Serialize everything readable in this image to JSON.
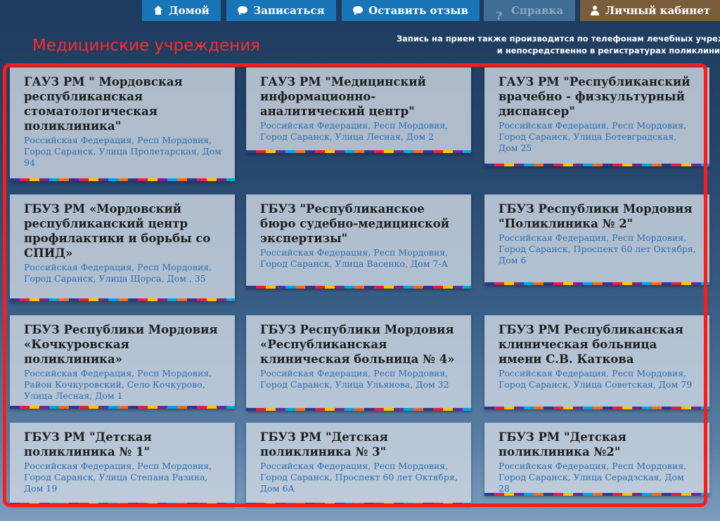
{
  "nav": {
    "home": "Домой",
    "signup": "Записаться",
    "feedback": "Оставить отзыв",
    "help": "Справка",
    "cabinet": "Личный кабинет"
  },
  "notice": {
    "line1": "Запись на прием также производится по телефонам лечебных учреждени",
    "line2": "и непосредственно в регистратурах поликлини"
  },
  "section_title": "Медицинские учреждения",
  "institutions": [
    {
      "name": "ГАУЗ РМ \" Мордовская республиканская стоматологическая поликлиника\"",
      "address": "Российская Федерация, Респ Мордовия, Город Саранск, Улица Пролетарская, Дом 94"
    },
    {
      "name": "ГАУЗ РМ \"Медицинский информационно-аналитический центр\"",
      "address": "Российская Федерация, Респ Мордовия, Город Саранск, Улица Лесная, Дом 2"
    },
    {
      "name": "ГАУЗ РМ \"Республиканский врачебно - физкультурный диспансер\"",
      "address": "Российская Федерация, Респ Мордовия, Город Саранск, Улица Ботевградская, Дом 25"
    },
    {
      "name": "ГБУЗ РМ «Мордовский республиканский центр профилактики и борьбы со СПИД»",
      "address": "Российская Федерация, Респ Мордовия, Город Саранск, Улица Щорса, Дом , 35"
    },
    {
      "name": "ГБУЗ \"Республиканское бюро судебно-медицинской экспертизы\"",
      "address": "Российская Федерация, Респ Мордовия, Город Саранск, Улица Васенко, Дом 7-А"
    },
    {
      "name": "ГБУЗ Республики Мордовия \"Поликлиника № 2\"",
      "address": "Российская Федерация, Респ Мордовия, Город Саранск, Проспект 60 лет Октября, Дом 6"
    },
    {
      "name": "ГБУЗ Республики Мордовия «Кочкуровская поликлиника»",
      "address": "Российская Федерация, Респ Мордовия, Район Кочкуровский, Село Кочкурово, Улица Лесная, Дом 1"
    },
    {
      "name": "ГБУЗ Республики Мордовия «Республиканская клиническая больница № 4»",
      "address": "Российская Федерация, Респ Мордовия, Город Саранск, Улица Ульянова, Дом 32"
    },
    {
      "name": "ГБУЗ РМ Республиканская клиническая больница имени С.В. Каткова",
      "address": "Российская Федерация, Респ Мордовия, Город Саранск, Улица Советская, Дом 79"
    },
    {
      "name": "ГБУЗ РМ \"Детская поликлиника № 1\"",
      "address": "Российская Федерация, Респ Мордовия, Город Саранск, Улица Степана Разина, Дом 19"
    },
    {
      "name": "ГБУЗ РМ \"Детская поликлиника № 3\"",
      "address": "Российская Федерация, Респ Мордовия, Город Саранск, Проспект 60 лет Октября, Дом 6А"
    },
    {
      "name": "ГБУЗ РМ \"Детская поликлиника №2\"",
      "address": "Российская Федерация, Респ Мордовия, Город Саранск, Улица Серадзская, Дом 28"
    }
  ]
}
